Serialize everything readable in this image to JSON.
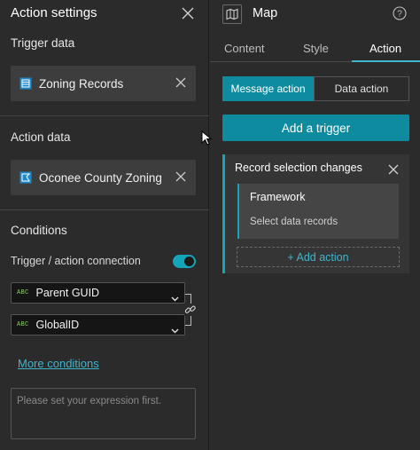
{
  "action_settings": {
    "title": "Action settings",
    "trigger_data": {
      "label": "Trigger data",
      "source": "Zoning Records",
      "source_icon": "table-icon"
    },
    "action_data": {
      "label": "Action data",
      "source": "Oconee County Zoning",
      "source_icon": "feature-layer-icon"
    },
    "conditions": {
      "label": "Conditions",
      "connection_label": "Trigger / action connection",
      "connection_enabled": true,
      "trigger_field": {
        "type_tag": "ABC",
        "name": "Parent GUID"
      },
      "action_field": {
        "type_tag": "ABC",
        "name": "GlobalID"
      },
      "more_link": "More conditions",
      "expression_placeholder": "Please set your expression first."
    }
  },
  "widget": {
    "title": "Map",
    "icon": "map-icon",
    "tabs": [
      {
        "label": "Content",
        "active": false
      },
      {
        "label": "Style",
        "active": false
      },
      {
        "label": "Action",
        "active": true
      }
    ],
    "segments": [
      {
        "label": "Message action",
        "active": true
      },
      {
        "label": "Data action",
        "active": false
      }
    ],
    "add_trigger_label": "Add a trigger",
    "trigger_card": {
      "title": "Record selection changes",
      "framework": {
        "title": "Framework",
        "subtitle": "Select data records"
      },
      "add_action_label": "+ Add action"
    }
  },
  "colors": {
    "background": "#2b2b2b",
    "accent": "#0f8ba0",
    "link": "#3fb5cc",
    "field_type": "#8ecf6a"
  }
}
